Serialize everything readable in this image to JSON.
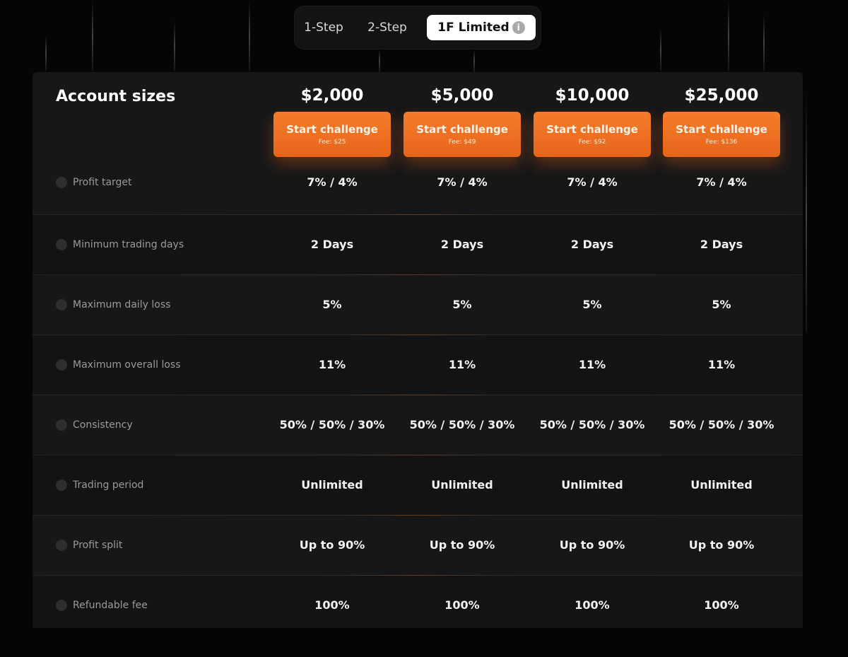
{
  "tabs": [
    {
      "label": "1-Step",
      "active": false
    },
    {
      "label": "2-Step",
      "active": false
    },
    {
      "label": "1F Limited",
      "active": true,
      "icon": "info-icon"
    }
  ],
  "table": {
    "heading": "Account sizes",
    "accent_color": "#f0701f",
    "columns": [
      {
        "price": "$2,000",
        "cta": "Start challenge",
        "fee": "Fee: $25"
      },
      {
        "price": "$5,000",
        "cta": "Start challenge",
        "fee": "Fee: $49"
      },
      {
        "price": "$10,000",
        "cta": "Start challenge",
        "fee": "Fee: $92"
      },
      {
        "price": "$25,000",
        "cta": "Start challenge",
        "fee": "Fee: $136"
      }
    ],
    "rows": [
      {
        "label": "Profit target",
        "icon": "info-icon",
        "values": [
          "7% / 4%",
          "7% / 4%",
          "7% / 4%",
          "7% / 4%"
        ]
      },
      {
        "label": "Minimum trading days",
        "icon": "info-icon",
        "values": [
          "2 Days",
          "2 Days",
          "2 Days",
          "2 Days"
        ]
      },
      {
        "label": "Maximum daily loss",
        "icon": "info-icon",
        "values": [
          "5%",
          "5%",
          "5%",
          "5%"
        ]
      },
      {
        "label": "Maximum overall loss",
        "icon": "info-icon",
        "values": [
          "11%",
          "11%",
          "11%",
          "11%"
        ]
      },
      {
        "label": "Consistency",
        "icon": "info-icon",
        "values": [
          "50% / 50% / 30%",
          "50% / 50% / 30%",
          "50% / 50% / 30%",
          "50% / 50% / 30%"
        ]
      },
      {
        "label": "Trading period",
        "icon": "info-icon",
        "values": [
          "Unlimited",
          "Unlimited",
          "Unlimited",
          "Unlimited"
        ]
      },
      {
        "label": "Profit split",
        "icon": "info-icon",
        "values": [
          "Up to 90%",
          "Up to 90%",
          "Up to 90%",
          "Up to 90%"
        ]
      },
      {
        "label": "Refundable fee",
        "icon": "info-icon",
        "values": [
          "100%",
          "100%",
          "100%",
          "100%"
        ]
      }
    ]
  }
}
